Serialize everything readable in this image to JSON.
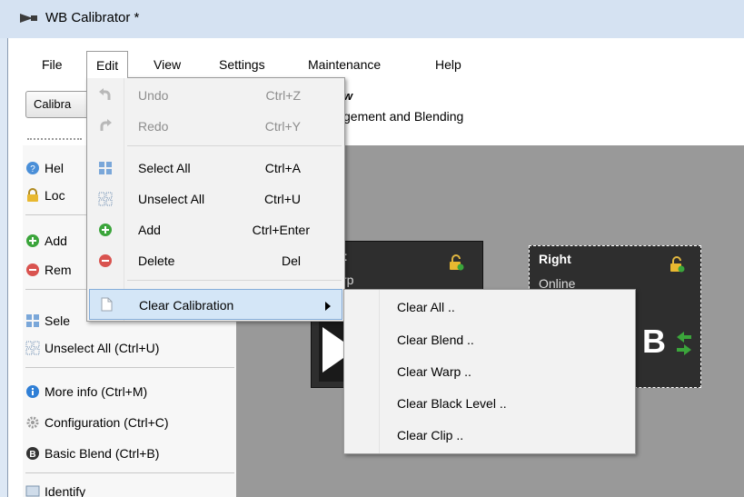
{
  "window": {
    "title": "WB Calibrator *"
  },
  "menubar": {
    "items": [
      {
        "label": "File"
      },
      {
        "label": "Edit"
      },
      {
        "label": "View"
      },
      {
        "label": "Settings"
      },
      {
        "label": "Maintenance"
      },
      {
        "label": "Help"
      }
    ]
  },
  "toolbar": {
    "calibrate_label": "Calibra"
  },
  "header": {
    "title": "w",
    "subtitle": "gement and Blending"
  },
  "left_panel": {
    "items": [
      {
        "label": "Hel",
        "icon": "help-icon"
      },
      {
        "label": "Loc",
        "icon": "lock-icon"
      },
      {
        "label": "Add",
        "icon": "add-icon"
      },
      {
        "label": "Rem",
        "icon": "remove-icon"
      },
      {
        "label": "Sele",
        "icon": "select-all-icon"
      },
      {
        "label": "Unselect All (Ctrl+U)",
        "icon": "unselect-all-icon"
      },
      {
        "label": "More info (Ctrl+M)",
        "icon": "info-icon"
      },
      {
        "label": "Configuration (Ctrl+C)",
        "icon": "gear-icon"
      },
      {
        "label": "Basic Blend (Ctrl+B)",
        "icon": "blend-icon"
      },
      {
        "label": "Identify",
        "icon": "identify-icon"
      }
    ]
  },
  "projectors": {
    "left": {
      "name": "t",
      "status": "rp"
    },
    "right": {
      "name": "Right",
      "status": "Online",
      "letter": "B"
    }
  },
  "edit_menu": {
    "items": [
      {
        "label": "Undo",
        "shortcut": "Ctrl+Z",
        "icon": "undo-icon"
      },
      {
        "label": "Redo",
        "shortcut": "Ctrl+Y",
        "icon": "redo-icon"
      },
      {
        "label": "Select All",
        "shortcut": "Ctrl+A",
        "icon": "select-all-icon"
      },
      {
        "label": "Unselect All",
        "shortcut": "Ctrl+U",
        "icon": "unselect-all-icon"
      },
      {
        "label": "Add",
        "shortcut": "Ctrl+Enter",
        "icon": "add-icon"
      },
      {
        "label": "Delete",
        "shortcut": "Del",
        "icon": "delete-icon"
      },
      {
        "label": "Clear Calibration",
        "shortcut": "",
        "icon": "document-icon"
      }
    ]
  },
  "clear_submenu": {
    "items": [
      {
        "label": "Clear All .."
      },
      {
        "label": "Clear Blend .."
      },
      {
        "label": "Clear Warp .."
      },
      {
        "label": "Clear Black Level .."
      },
      {
        "label": "Clear Clip .."
      }
    ]
  },
  "colors": {
    "titlebar": "#d5e2f2",
    "canvas": "#999999",
    "menu_highlight": "#d4e6f7",
    "add_green": "#3ba53b",
    "delete_red": "#d9534f",
    "info_blue": "#2f7fd6"
  }
}
